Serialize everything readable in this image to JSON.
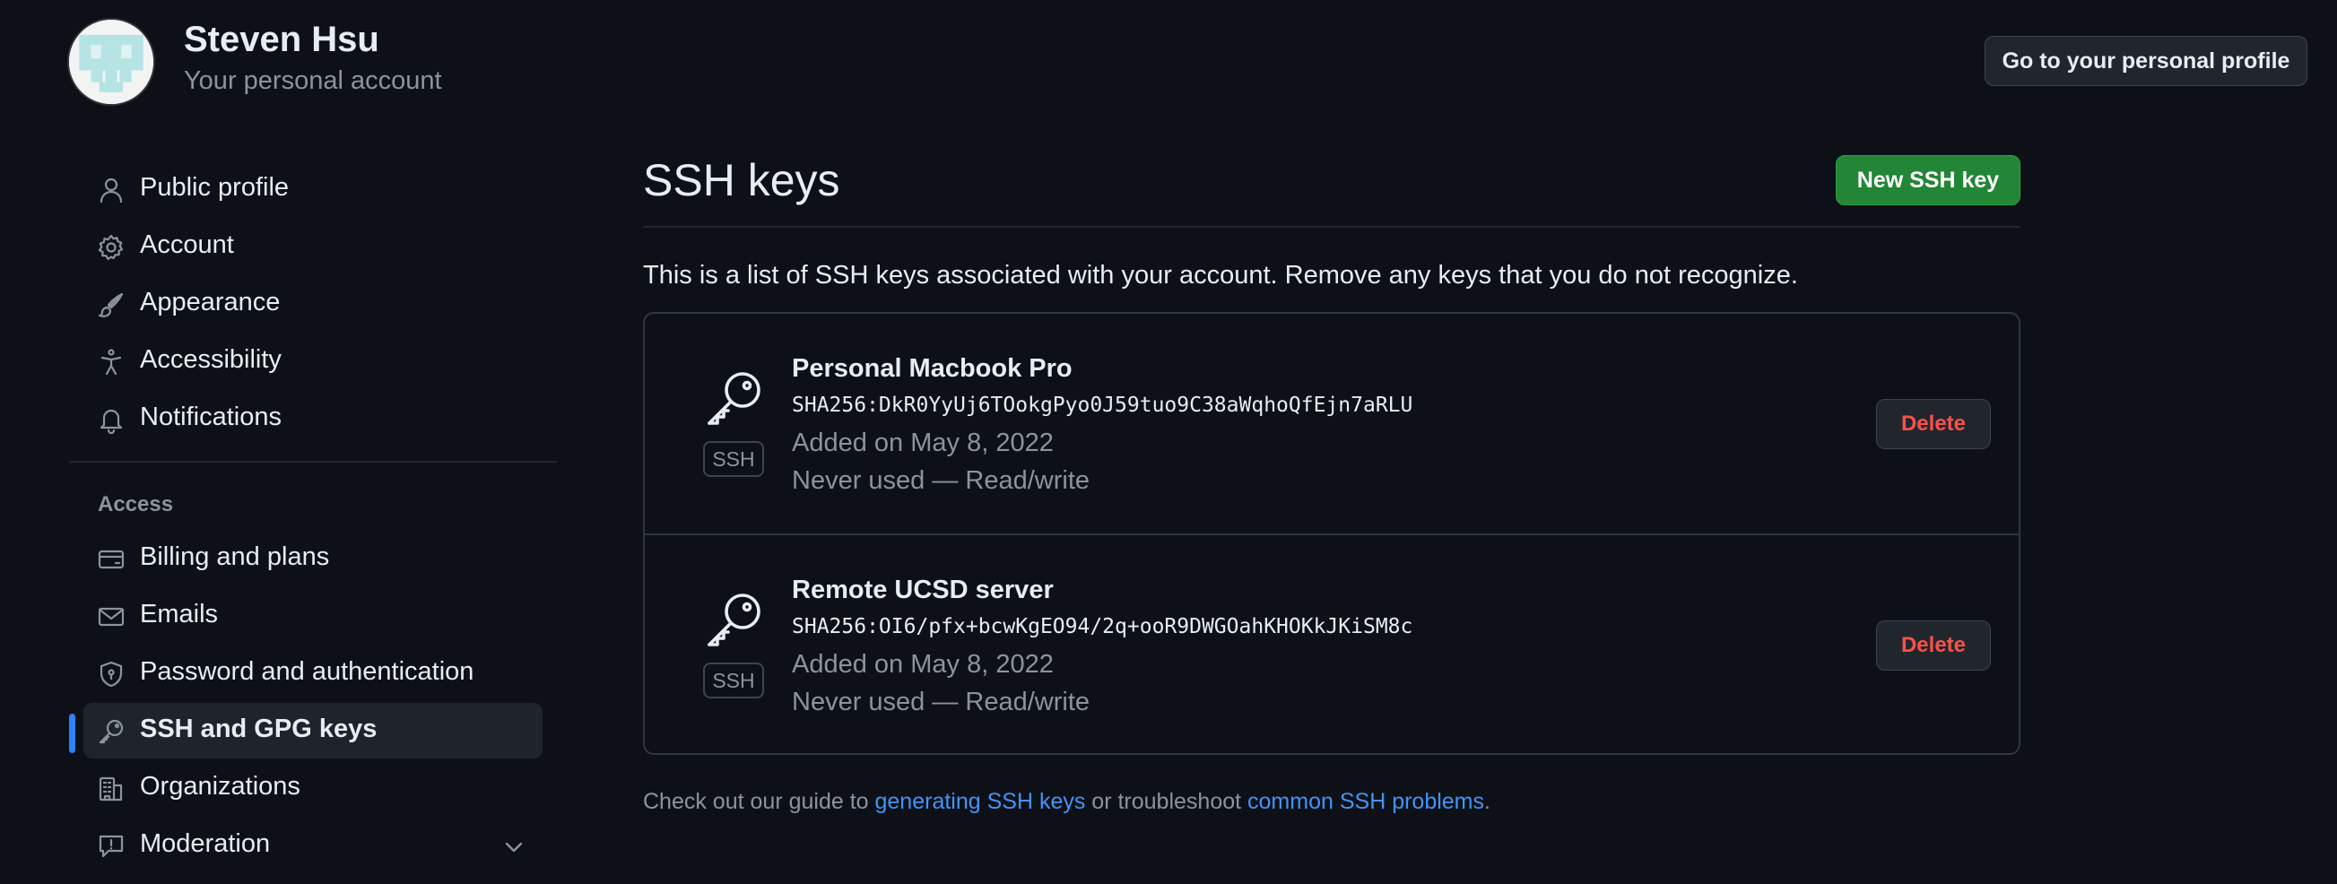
{
  "header": {
    "name": "Steven Hsu",
    "subtitle": "Your personal account",
    "profile_button": "Go to your personal profile"
  },
  "sidebar": {
    "items": [
      {
        "label": "Public profile",
        "icon": "person-icon"
      },
      {
        "label": "Account",
        "icon": "gear-icon"
      },
      {
        "label": "Appearance",
        "icon": "paintbrush-icon"
      },
      {
        "label": "Accessibility",
        "icon": "accessibility-icon"
      },
      {
        "label": "Notifications",
        "icon": "bell-icon"
      }
    ],
    "access_heading": "Access",
    "access_items": [
      {
        "label": "Billing and plans",
        "icon": "credit-card-icon"
      },
      {
        "label": "Emails",
        "icon": "mail-icon"
      },
      {
        "label": "Password and authentication",
        "icon": "shield-lock-icon"
      },
      {
        "label": "SSH and GPG keys",
        "icon": "key-icon",
        "active": true
      },
      {
        "label": "Organizations",
        "icon": "organization-icon"
      },
      {
        "label": "Moderation",
        "icon": "report-icon",
        "expandable": true
      }
    ]
  },
  "main": {
    "title": "SSH keys",
    "new_key_button": "New SSH key",
    "intro": "This is a list of SSH keys associated with your account. Remove any keys that you do not recognize.",
    "keys": [
      {
        "title": "Personal Macbook Pro",
        "badge": "SSH",
        "fingerprint": "SHA256:DkR0YyUj6TOokgPyo0J59tuo9C38aWqhoQfEjn7aRLU",
        "added": "Added on May 8, 2022",
        "usage": "Never used — Read/write",
        "delete_label": "Delete"
      },
      {
        "title": "Remote UCSD server",
        "badge": "SSH",
        "fingerprint": "SHA256:OI6/pfx+bcwKgEO94/2q+ooR9DWGOahKHOKkJKiSM8c",
        "added": "Added on May 8, 2022",
        "usage": "Never used — Read/write",
        "delete_label": "Delete"
      }
    ],
    "footer": {
      "prefix": "Check out our guide to ",
      "link1": "generating SSH keys",
      "middle": " or troubleshoot ",
      "link2": "common SSH problems",
      "suffix": "."
    }
  },
  "colors": {
    "background": "#0d1117",
    "accent_blue": "#2f81f7",
    "link": "#4493f8",
    "primary_button": "#238636",
    "danger": "#f85149",
    "muted_text": "#8b949e",
    "border": "#30363d"
  }
}
